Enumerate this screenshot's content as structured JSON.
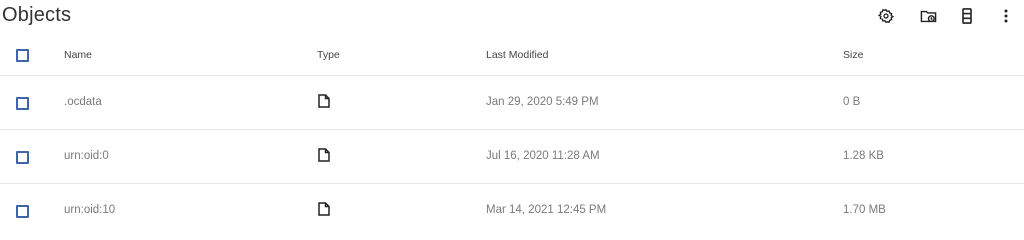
{
  "header": {
    "title": "Objects",
    "icons": [
      "settings-icon",
      "folder-clock-icon",
      "storage-icon",
      "more-vert-icon"
    ]
  },
  "table": {
    "columns": {
      "name": "Name",
      "type": "Type",
      "modified": "Last Modified",
      "size": "Size"
    },
    "rows": [
      {
        "name": ".ocdata",
        "type_icon": "file-icon",
        "modified": "Jan 29, 2020 5:49 PM",
        "size": "0 B"
      },
      {
        "name": "urn:oid:0",
        "type_icon": "file-icon",
        "modified": "Jul 16, 2020 11:28 AM",
        "size": "1.28 KB"
      },
      {
        "name": "urn:oid:10",
        "type_icon": "file-icon",
        "modified": "Mar 14, 2021 12:45 PM",
        "size": "1.70 MB"
      }
    ]
  },
  "colors": {
    "checkbox_border": "#3f64a8",
    "divider": "#e6e6e6"
  }
}
